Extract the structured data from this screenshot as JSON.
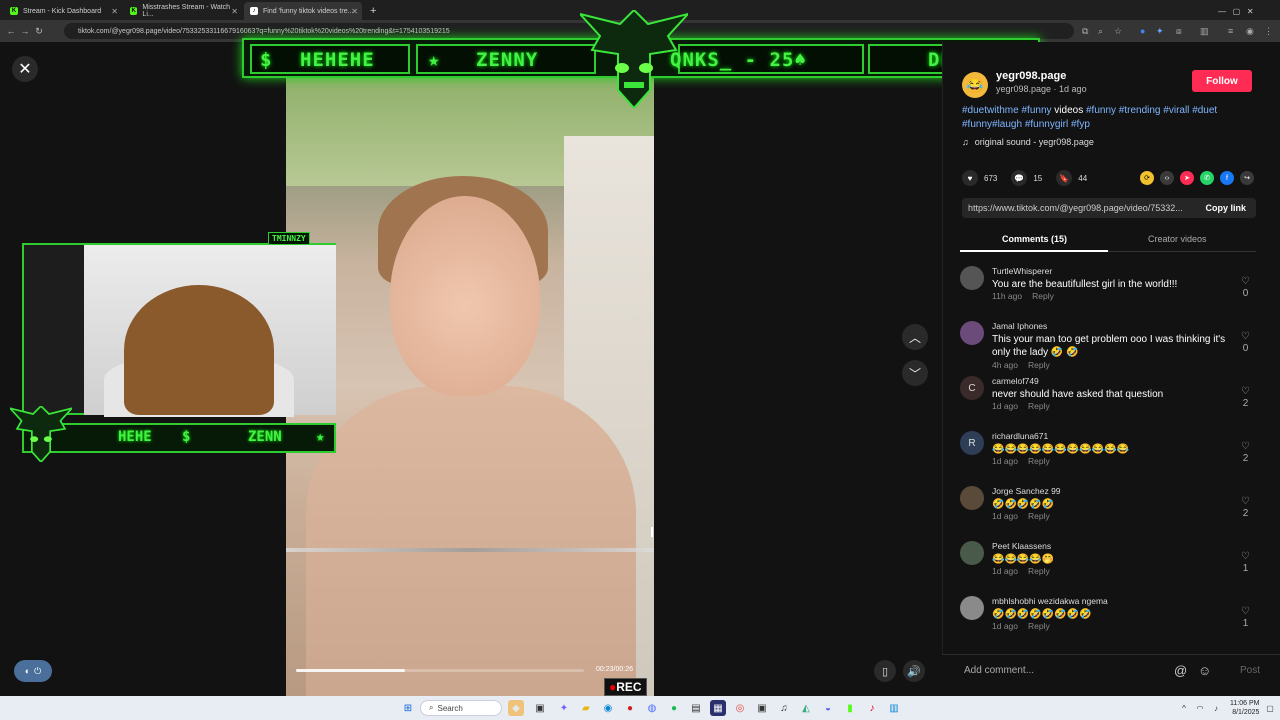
{
  "browser": {
    "tabs": [
      {
        "title": "Stream - Kick Dashboard",
        "icon": "kick-icon",
        "color": "#53fc18"
      },
      {
        "title": "Misstrashes Stream - Watch Li...",
        "icon": "kick-icon",
        "color": "#53fc18"
      },
      {
        "title": "Find 'funny tiktok videos tre...",
        "icon": "tiktok-icon",
        "color": "#ffffff"
      }
    ],
    "new_tab": "+",
    "url": "tiktok.com/@yegr098.page/video/7533253311667916063?q=funny%20tiktok%20videos%20trending&t=1754103519215"
  },
  "overlay": {
    "ticker_items": [
      "$",
      "HEHEHE",
      "★",
      "ZENNY",
      "QNKS_ - 25♠",
      "DENA♥"
    ],
    "cam_ticker": [
      "HEHE",
      "$",
      "ZENN",
      "★"
    ],
    "cam_name": "TMINNZY",
    "rec": "REC",
    "time": "00:23/00:26"
  },
  "video": {
    "progress": 0.38
  },
  "post": {
    "username": "yegr098.page",
    "meta": "yegr098.page · 1d ago",
    "follow": "Follow",
    "caption_tags": [
      "#duetwithme",
      "#funny",
      "videos",
      "#funny",
      "#trending",
      "#virall",
      "#duet",
      "#funny#laugh",
      "#funnygirl",
      "#fyp"
    ],
    "sound": "original sound - yegr098.page",
    "likes": "673",
    "comments": "15",
    "saves": "44",
    "link": "https://www.tiktok.com/@yegr098.page/video/75332...",
    "copy_link": "Copy link",
    "tab_comments": "Comments (15)",
    "tab_creator": "Creator videos",
    "share_colors": [
      "#f2c12e",
      "#3a3a3a",
      "#fe2c55",
      "#25d366",
      "#1877f2",
      "#3a3a3a"
    ]
  },
  "comments": [
    {
      "name": "TurtleWhisperer",
      "text": "You are the beautifullest girl in the world!!!",
      "time": "11h ago",
      "reply": "Reply",
      "likes": "0",
      "avatar": ""
    },
    {
      "name": "Jamal Iphones",
      "text": "This your man too get problem ooo I was thinking it's only the lady 🤣 🤣",
      "time": "4h ago",
      "reply": "Reply",
      "likes": "0",
      "avatar": ""
    },
    {
      "name": "carmelof749",
      "text": "never should have asked that question",
      "time": "1d ago",
      "reply": "Reply",
      "likes": "2",
      "avatar": "C"
    },
    {
      "name": "richardluna671",
      "text": "😂😂😂😂😂😂😂😂😂😂😂",
      "time": "1d ago",
      "reply": "Reply",
      "likes": "2",
      "avatar": "R"
    },
    {
      "name": "Jorge Sanchez 99",
      "text": "🤣🤣🤣🤣🤣",
      "time": "1d ago",
      "reply": "Reply",
      "likes": "2",
      "avatar": ""
    },
    {
      "name": "Peet Klaassens",
      "text": "😂😂😂😂🤭",
      "time": "1d ago",
      "reply": "Reply",
      "likes": "1",
      "avatar": ""
    },
    {
      "name": "mbhlshobhi wezidakwa ngema",
      "text": "🤣🤣🤣🤣🤣🤣🤣🤣",
      "time": "1d ago",
      "reply": "Reply",
      "likes": "1",
      "avatar": ""
    }
  ],
  "composer": {
    "placeholder": "Add comment...",
    "post": "Post"
  },
  "taskbar": {
    "search": "Search",
    "time": "11:06 PM",
    "date": "8/1/2025"
  }
}
